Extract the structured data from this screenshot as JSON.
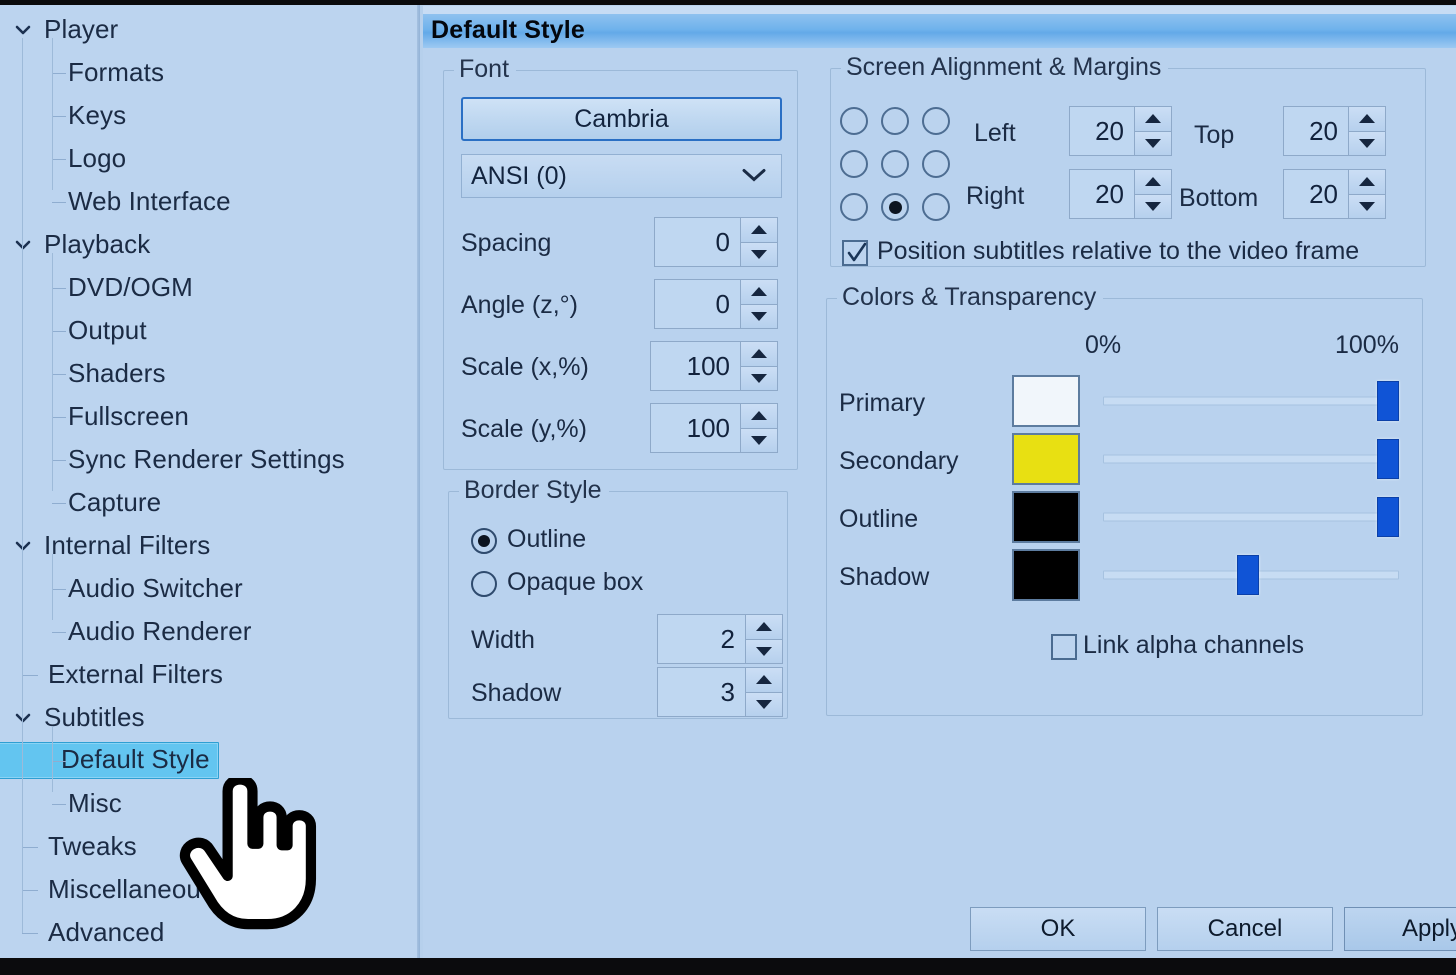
{
  "window": {
    "title": "Default Style"
  },
  "sidebar": {
    "items": [
      {
        "label": "Player",
        "level": 0,
        "expandable": true,
        "expanded": true,
        "selected": false
      },
      {
        "label": "Formats",
        "level": 1,
        "expandable": false,
        "expanded": false,
        "selected": false
      },
      {
        "label": "Keys",
        "level": 1,
        "expandable": false,
        "expanded": false,
        "selected": false
      },
      {
        "label": "Logo",
        "level": 1,
        "expandable": false,
        "expanded": false,
        "selected": false
      },
      {
        "label": "Web Interface",
        "level": 1,
        "expandable": false,
        "expanded": false,
        "selected": false
      },
      {
        "label": "Playback",
        "level": 0,
        "expandable": true,
        "expanded": true,
        "selected": false
      },
      {
        "label": "DVD/OGM",
        "level": 1,
        "expandable": false,
        "expanded": false,
        "selected": false
      },
      {
        "label": "Output",
        "level": 1,
        "expandable": false,
        "expanded": false,
        "selected": false
      },
      {
        "label": "Shaders",
        "level": 1,
        "expandable": false,
        "expanded": false,
        "selected": false
      },
      {
        "label": "Fullscreen",
        "level": 1,
        "expandable": false,
        "expanded": false,
        "selected": false
      },
      {
        "label": "Sync Renderer Settings",
        "level": 1,
        "expandable": false,
        "expanded": false,
        "selected": false
      },
      {
        "label": "Capture",
        "level": 1,
        "expandable": false,
        "expanded": false,
        "selected": false
      },
      {
        "label": "Internal Filters",
        "level": 0,
        "expandable": true,
        "expanded": true,
        "selected": false
      },
      {
        "label": "Audio Switcher",
        "level": 1,
        "expandable": false,
        "expanded": false,
        "selected": false
      },
      {
        "label": "Audio Renderer",
        "level": 1,
        "expandable": false,
        "expanded": false,
        "selected": false
      },
      {
        "label": "External Filters",
        "level": 0,
        "expandable": false,
        "expanded": false,
        "selected": false
      },
      {
        "label": "Subtitles",
        "level": 0,
        "expandable": true,
        "expanded": true,
        "selected": false
      },
      {
        "label": "Default Style",
        "level": 1,
        "expandable": false,
        "expanded": false,
        "selected": true
      },
      {
        "label": "Misc",
        "level": 1,
        "expandable": false,
        "expanded": false,
        "selected": false
      },
      {
        "label": "Tweaks",
        "level": 0,
        "expandable": false,
        "expanded": false,
        "selected": false
      },
      {
        "label": "Miscellaneous",
        "level": 0,
        "expandable": false,
        "expanded": false,
        "selected": false
      },
      {
        "label": "Advanced",
        "level": 0,
        "expandable": false,
        "expanded": false,
        "selected": false
      }
    ]
  },
  "font_group": {
    "legend": "Font",
    "font_name": "Cambria",
    "charset": "ANSI (0)",
    "fields": [
      {
        "label": "Spacing",
        "value": "0"
      },
      {
        "label": "Angle (z,°)",
        "value": "0"
      },
      {
        "label": "Scale (x,%)",
        "value": "100"
      },
      {
        "label": "Scale (y,%)",
        "value": "100"
      }
    ]
  },
  "border_group": {
    "legend": "Border Style",
    "options": [
      {
        "label": "Outline",
        "selected": true
      },
      {
        "label": "Opaque box",
        "selected": false
      }
    ],
    "fields": [
      {
        "label": "Width",
        "value": "2"
      },
      {
        "label": "Shadow",
        "value": "3"
      }
    ]
  },
  "alignment_group": {
    "legend": "Screen Alignment & Margins",
    "alignment_selected_index": 7,
    "alignment_cells": [
      "top-left",
      "top-center",
      "top-right",
      "middle-left",
      "middle-center",
      "middle-right",
      "bottom-left",
      "bottom-center",
      "bottom-right"
    ],
    "margins": [
      {
        "label": "Left",
        "value": "20"
      },
      {
        "label": "Top",
        "value": "20"
      },
      {
        "label": "Right",
        "value": "20"
      },
      {
        "label": "Bottom",
        "value": "20"
      }
    ],
    "relative_checkbox": {
      "label": "Position subtitles relative to the video frame",
      "checked": true
    }
  },
  "colors_group": {
    "legend": "Colors & Transparency",
    "scale_min_label": "0%",
    "scale_max_label": "100%",
    "rows": [
      {
        "label": "Primary",
        "color": "#f1f6fb",
        "alpha_percent": 100
      },
      {
        "label": "Secondary",
        "color": "#e8e012",
        "alpha_percent": 100
      },
      {
        "label": "Outline",
        "color": "#000000",
        "alpha_percent": 100
      },
      {
        "label": "Shadow",
        "color": "#000000",
        "alpha_percent": 49
      }
    ],
    "link_checkbox": {
      "label": "Link alpha channels",
      "checked": false
    }
  },
  "footer": {
    "buttons": [
      {
        "label": "OK",
        "primary": false
      },
      {
        "label": "Cancel",
        "primary": false
      },
      {
        "label": "Apply",
        "primary": true
      }
    ]
  },
  "theme": {
    "panel_bg": "#b9d2ee",
    "sidebar_bg": "#bcd4ef",
    "accent": "#1054d6",
    "selection": "#63c5f0",
    "title_gradient_start": "#8fc2ef",
    "title_gradient_end": "#9dc9f2"
  },
  "cursor": {
    "icon": "pointing-hand-cursor"
  }
}
